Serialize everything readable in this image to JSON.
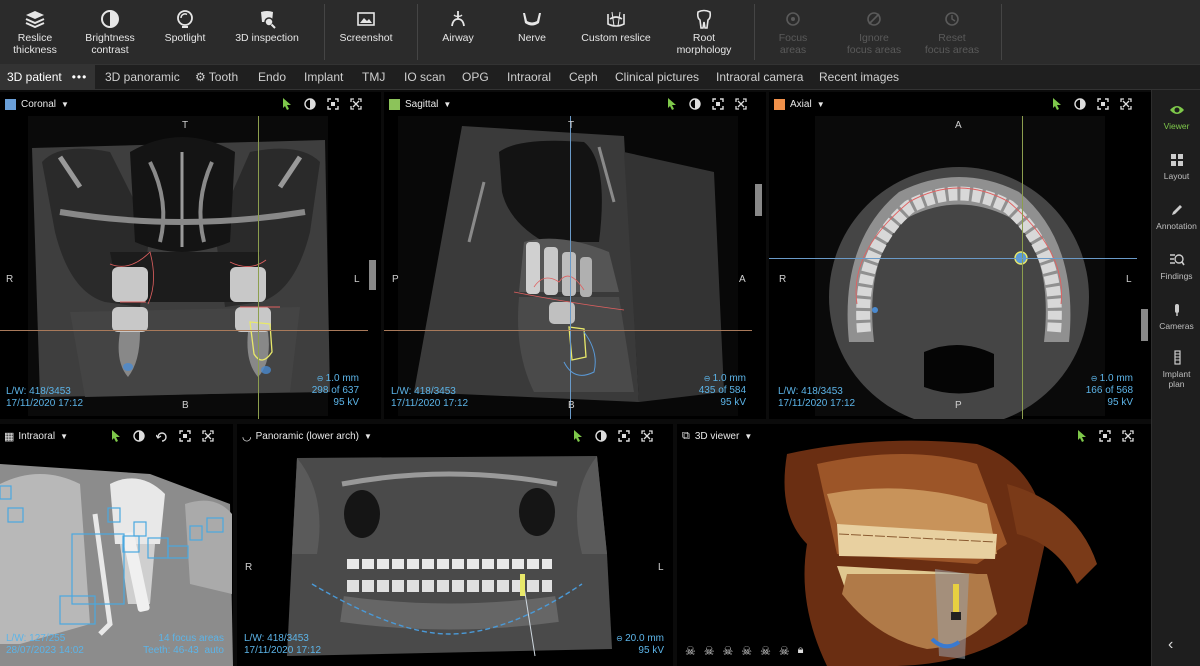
{
  "toolbar": {
    "tools": [
      {
        "line1": "Reslice",
        "line2": "thickness",
        "icon": "layers-icon",
        "enabled": true
      },
      {
        "line1": "Brightness",
        "line2": "contrast",
        "icon": "contrast-icon",
        "enabled": true
      },
      {
        "line1": "Spotlight",
        "line2": "",
        "icon": "spotlight-icon",
        "enabled": true
      },
      {
        "line1": "3D inspection",
        "line2": "",
        "icon": "inspection-icon",
        "enabled": true
      },
      {
        "line1": "Screenshot",
        "line2": "",
        "icon": "screenshot-icon",
        "enabled": true
      },
      {
        "line1": "Airway",
        "line2": "",
        "icon": "airway-icon",
        "enabled": true
      },
      {
        "line1": "Nerve",
        "line2": "",
        "icon": "nerve-icon",
        "enabled": true
      },
      {
        "line1": "Custom reslice",
        "line2": "",
        "icon": "custom-reslice-icon",
        "enabled": true
      },
      {
        "line1": "Root",
        "line2": "morphology",
        "icon": "tooth-icon",
        "enabled": true
      },
      {
        "line1": "Focus",
        "line2": "areas",
        "icon": "focus-icon",
        "enabled": false
      },
      {
        "line1": "Ignore",
        "line2": "focus areas",
        "icon": "ignore-icon",
        "enabled": false
      },
      {
        "line1": "Reset",
        "line2": "focus areas",
        "icon": "reset-icon",
        "enabled": false
      }
    ]
  },
  "tabs": [
    {
      "label": "3D patient",
      "active": true
    },
    {
      "label": "3D panoramic"
    },
    {
      "label": "Tooth"
    },
    {
      "label": "Endo"
    },
    {
      "label": "Implant"
    },
    {
      "label": "TMJ"
    },
    {
      "label": "IO scan"
    },
    {
      "label": "OPG"
    },
    {
      "label": "Intraoral"
    },
    {
      "label": "Ceph"
    },
    {
      "label": "Clinical pictures"
    },
    {
      "label": "Intraoral camera"
    },
    {
      "label": "Recent images"
    }
  ],
  "sidebar": [
    {
      "label": "Viewer",
      "icon": "eye-icon",
      "active": true
    },
    {
      "label": "Layout",
      "icon": "layout-icon"
    },
    {
      "label": "Annotation",
      "icon": "pencil-icon"
    },
    {
      "label": "Findings",
      "icon": "findings-icon"
    },
    {
      "label": "Cameras",
      "icon": "camera-icon"
    },
    {
      "label": "Implant plan",
      "icon": "implant-icon"
    }
  ],
  "viewports": {
    "coronal": {
      "title": "Coronal",
      "color": "#6a9fd8",
      "ori": {
        "top": "T",
        "bottom": "B",
        "left": "R",
        "right": "L"
      },
      "lw": "L/W: 418/3453",
      "date": "17/11/2020 17:12",
      "thickness": "1.0 mm",
      "slice": "298 of 637",
      "kv": "95 kV"
    },
    "sagittal": {
      "title": "Sagittal",
      "color": "#8cc35a",
      "ori": {
        "top": "T",
        "bottom": "B",
        "left": "P",
        "right": "A"
      },
      "lw": "L/W: 418/3453",
      "date": "17/11/2020 17:12",
      "thickness": "1.0 mm",
      "slice": "435 of 584",
      "kv": "95 kV"
    },
    "axial": {
      "title": "Axial",
      "color": "#f0904a",
      "ori": {
        "top": "A",
        "bottom": "P",
        "left": "R",
        "right": "L"
      },
      "lw": "L/W: 418/3453",
      "date": "17/11/2020 17:12",
      "thickness": "1.0 mm",
      "slice": "166 of 568",
      "kv": "95 kV"
    },
    "intraoral": {
      "title": "Intraoral",
      "lw": "L/W: 127/255",
      "date": "28/07/2023 14:02",
      "focus": "14 focus areas",
      "teeth": "Teeth: 46-43",
      "mode": "auto"
    },
    "panoramic": {
      "title": "Panoramic (lower arch)",
      "ori": {
        "left": "R",
        "right": "L"
      },
      "lw": "L/W: 418/3453",
      "date": "17/11/2020 17:12",
      "thickness": "20.0 mm",
      "kv": "95 kV"
    },
    "viewer3d": {
      "title": "3D viewer"
    }
  },
  "colors": {
    "accent": "#7ec84a",
    "overlay": "#5cb4e8",
    "cursor": "#7ec84a"
  }
}
